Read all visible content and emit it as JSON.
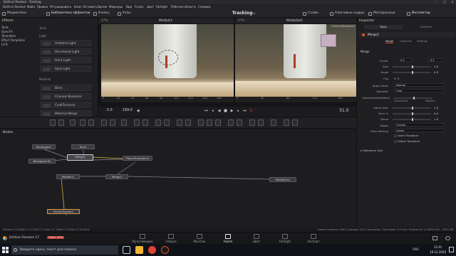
{
  "window": {
    "title": "DaVinci Resolve - Tracking"
  },
  "menu": [
    "DaVinci Resolve",
    "Файл",
    "Правка",
    "Ретушировать",
    "Клип",
    "Вставить",
    "Время",
    "Маркеры",
    "Вид",
    "Fusion",
    "Цвет",
    "Fairlight",
    "Рабочая область",
    "Справка"
  ],
  "toolbar": {
    "left": [
      "Медиатека",
      "Библиотека эффектов",
      "Клипы",
      "Узлы"
    ],
    "project_title": "Tracking",
    "project_state": "Сохранено",
    "right": [
      "Спайн",
      "Ключевые кадры",
      "Метаданные",
      "Инспектор"
    ]
  },
  "effects": {
    "header": "Effects",
    "tree": [
      "Tools",
      "OpenFX",
      "Templates",
      "Effect Templates",
      "LUTs"
    ],
    "tools_header": "Tools",
    "light_header": "Light",
    "light_items": [
      "Ambient Light",
      "Directional Light",
      "Point Light",
      "Spot Light"
    ],
    "material_header": "Material",
    "material_items": [
      "Blinn",
      "Channel Booleans",
      "CookTorrance",
      "Material Merge"
    ]
  },
  "viewer_left": {
    "title": "MediaIn1",
    "zoom": "47%",
    "ruler": [
      "0",
      "20",
      "40",
      "60",
      "80",
      "100",
      "120",
      "140",
      "160",
      "180"
    ]
  },
  "viewer_right": {
    "title": "MediaOut1",
    "zoom": "47%",
    "resolution": "1920x1080xfloat16",
    "ruler": [
      "0",
      "40",
      "80",
      "120",
      "160"
    ]
  },
  "transport": {
    "start_frame": "0.0",
    "end_frame": "189.0",
    "current_frame": "31.0"
  },
  "nodes": {
    "header": "Nodes",
    "items": [
      "Rectangle1",
      "Text1",
      "Background1",
      "Merge2",
      "PlanarTransform1",
      "MediaIn1",
      "Merge1",
      "MediaOut1",
      "PlanarTracker1"
    ]
  },
  "inspector": {
    "header": "Inspector",
    "node_name": "Merge2",
    "top_tabs": [
      "Tools",
      "Modifiers"
    ],
    "tabs": [
      "Merge",
      "Channels",
      "Settings"
    ],
    "section": "Merge",
    "rows": {
      "center_label": "Center",
      "center_x": "0.5",
      "center_y": "0.5",
      "size_label": "Size",
      "size_value": "1.0",
      "angle_label": "Angle",
      "angle_value": "0.0",
      "flip_label": "Flip",
      "apply_mode_label": "Apply Mode",
      "apply_mode_value": "Normal",
      "operator_label": "Operator",
      "operator_value": "Over",
      "subadd_label": "Subtractive/Additive",
      "subtractive": "Subtractive",
      "additive": "Additive",
      "alpha_gain_label": "Alpha Gain",
      "alpha_gain_value": "1.0",
      "burn_in_label": "Burn In",
      "burn_in_value": "0.0",
      "blend_label": "Blend",
      "blend_value": "1.0",
      "edges_label": "Edges",
      "edges_value": "Canvas",
      "filter_label": "Filter Method",
      "filter_value": "Linear",
      "invert_transform": "Invert Transform",
      "flatten_transform": "Flatten Transform",
      "reference_size": "Reference Size"
    }
  },
  "status": {
    "left": "Position  X 0.26460  Y 0.17236  Z 0  Color X 0.78895  Y 0.29811  Z 0.22891",
    "right": "Frames rendered: 189.0, Average: 19.02 frames/sec, Time taken: 9.9 secs, Finished at: 12:28PM  29% - 9095 MB"
  },
  "pagebar": {
    "app": "DaVinci Resolve 17",
    "badge": "PUBLIC BETA",
    "pages": [
      "Мультимедиа",
      "Сборка",
      "Монтаж",
      "Fusion",
      "Цвет",
      "Fairlight",
      "Экспорт"
    ],
    "active_page": "Fusion"
  },
  "taskbar": {
    "search_placeholder": "Введите здесь текст для поиска",
    "language": "ENG",
    "time": "12:41",
    "date": "19.12.2020"
  },
  "colors": {
    "accent": "#e84b2e",
    "node_selected": "#cfcfd4",
    "tracker_node": "#e09a3d"
  }
}
